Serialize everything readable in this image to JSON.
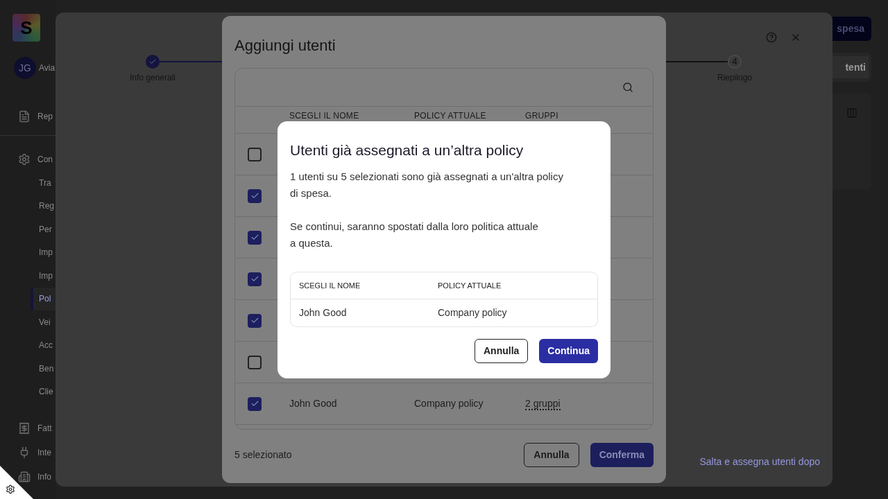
{
  "sidebar": {
    "logo_letter": "S",
    "user": {
      "initials": "JG",
      "name": "Avia"
    },
    "items": [
      {
        "label": "Rep",
        "selected": false
      },
      {
        "label": "Con",
        "selected": false,
        "children": [
          {
            "label": "Tra",
            "selected": false
          },
          {
            "label": "Reg",
            "selected": false
          },
          {
            "label": "Per",
            "selected": false
          },
          {
            "label": "Imp",
            "selected": false
          },
          {
            "label": "Imp",
            "selected": false
          },
          {
            "label": "Pol",
            "selected": true
          },
          {
            "label": "Vei",
            "selected": false
          },
          {
            "label": "Acc",
            "selected": false
          },
          {
            "label": "Ben",
            "selected": false
          },
          {
            "label": "Clie",
            "selected": false
          }
        ]
      },
      {
        "label": "Fatt",
        "selected": false
      },
      {
        "label": "Inte",
        "selected": false
      },
      {
        "label": "Info",
        "selected": false
      }
    ]
  },
  "page_actions": {
    "primary_button": "spesa",
    "secondary_button": "tenti"
  },
  "wizard": {
    "steps": [
      {
        "label": "Info generali",
        "done": true
      },
      {
        "label": "Riepilogo",
        "number": "4",
        "done": false
      }
    ],
    "skip_link": "Salta e assegna utenti dopo"
  },
  "add_users": {
    "title": "Aggiungi utenti",
    "columns": [
      "SCEGLI IL NOME",
      "POLICY ATTUALE",
      "GRUPPI"
    ],
    "rows": [
      {
        "checked": false
      },
      {
        "checked": true
      },
      {
        "checked": true
      },
      {
        "checked": true
      },
      {
        "checked": true
      },
      {
        "checked": false
      },
      {
        "checked": true,
        "name": "John Good",
        "policy": "Company policy",
        "groups": "2 gruppi"
      }
    ],
    "selected_count": "5 selezionato",
    "cancel": "Annulla",
    "confirm": "Conferma"
  },
  "dialog": {
    "title": "Utenti già assegnati a un’altra policy",
    "paragraphs": [
      "1 utenti su 5 selezionati sono già assegnati a un'altra policy di spesa.",
      "Se continui, saranno spostati dalla loro politica attuale a questa."
    ],
    "columns": [
      "SCEGLI IL NOME",
      "POLICY ATTUALE"
    ],
    "rows": [
      {
        "name": "John Good",
        "policy": "Company policy"
      }
    ],
    "cancel": "Annulla",
    "continue": "Continua"
  }
}
